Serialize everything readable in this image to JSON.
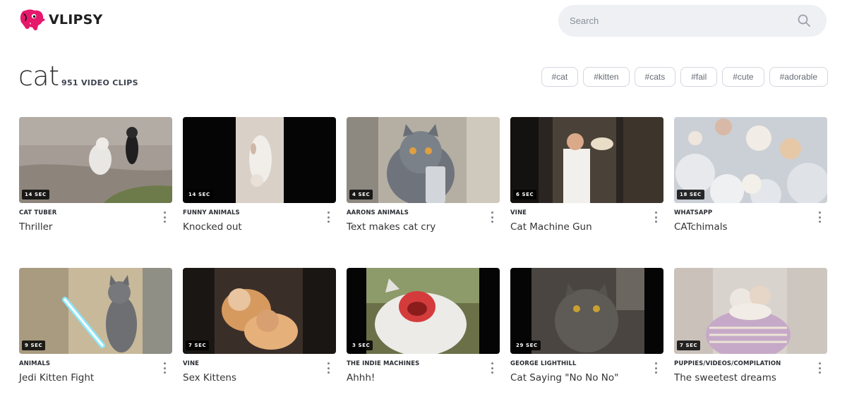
{
  "header": {
    "brand": "VLIPSY",
    "brand_color": "#e5186b",
    "search_placeholder": "Search"
  },
  "page": {
    "title": "cat",
    "count": "951 VIDEO CLIPS"
  },
  "tags": [
    "#cat",
    "#kitten",
    "#cats",
    "#fail",
    "#cute",
    "#adorable"
  ],
  "clips": [
    {
      "duration": "14 SEC",
      "channel": "CAT TUBER",
      "title": "Thriller"
    },
    {
      "duration": "14 SEC",
      "channel": "FUNNY ANIMALS",
      "title": "Knocked out"
    },
    {
      "duration": "4 SEC",
      "channel": "AARONS ANIMALS",
      "title": "Text makes cat cry"
    },
    {
      "duration": "6 SEC",
      "channel": "VINE",
      "title": "Cat Machine Gun"
    },
    {
      "duration": "18 SEC",
      "channel": "WHATSAPP",
      "title": "CATchimals"
    },
    {
      "duration": "9 SEC",
      "channel": "ANIMALS",
      "title": "Jedi Kitten Fight"
    },
    {
      "duration": "7 SEC",
      "channel": "VINE",
      "title": "Sex Kittens"
    },
    {
      "duration": "3 SEC",
      "channel": "THE INDIE MACHINES",
      "title": "Ahhh!"
    },
    {
      "duration": "29 SEC",
      "channel": "GEORGE LIGHTHILL",
      "title": "Cat Saying \"No No No\""
    },
    {
      "duration": "7 SEC",
      "channel": "PUPPIES/VIDEOS/COMPILATION",
      "title": "The sweetest dreams"
    }
  ],
  "icons": {
    "logo": "pink-elephant-logo-icon",
    "search": "search-icon",
    "more": "more-vertical-icon"
  }
}
